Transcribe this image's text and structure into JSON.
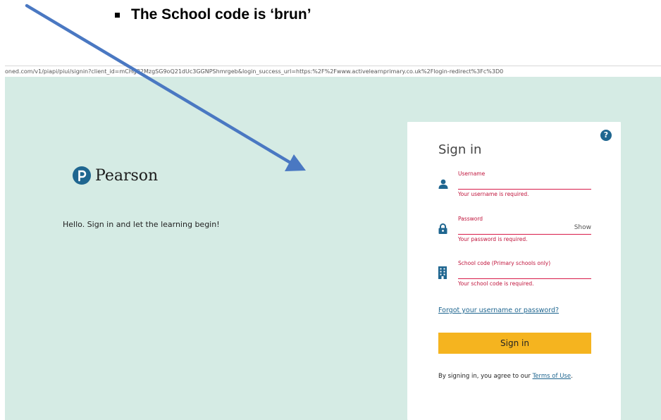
{
  "document": {
    "bullet_text": "The School code is ‘brun’"
  },
  "browser": {
    "url": "oned.com/v1/piapi/piui/signin?client_id=mCHg32MzgSG9oQ21dUc3GGNPShmrgeb&login_success_url=https:%2F%2Fwww.activelearnprimary.co.uk%2Flogin-redirect%3Fc%3D0"
  },
  "brand": {
    "name": "Pearson",
    "logo_letter": "P",
    "color": "#1f6690"
  },
  "tagline": "Hello. Sign in and let the learning begin!",
  "form": {
    "title": "Sign in",
    "help_icon": "?",
    "username": {
      "label": "Username",
      "icon": "user-icon",
      "value": "",
      "error": "Your username is required."
    },
    "password": {
      "label": "Password",
      "icon": "lock-icon",
      "value": "",
      "show_label": "Show",
      "error": "Your password is required."
    },
    "school_code": {
      "label": "School code (Primary schools only)",
      "icon": "building-icon",
      "value": "",
      "error": "Your school code is required."
    },
    "forgot_link": "Forgot your username or password?",
    "submit_label": "Sign in",
    "terms_prefix": "By signing in, you agree to our ",
    "terms_link": "Terms of Use",
    "terms_suffix": "."
  },
  "colors": {
    "page_bg": "#d5ebe4",
    "accent": "#f5b41f",
    "error": "#c0143c",
    "link": "#1f6690",
    "arrow": "#4a78c2"
  }
}
